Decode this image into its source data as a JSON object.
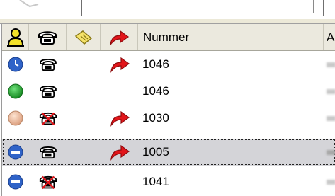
{
  "header": {
    "columns": [
      {
        "icon": "person-icon"
      },
      {
        "icon": "phone-icon"
      },
      {
        "icon": "note-icon"
      },
      {
        "icon": "forward-arrow-icon"
      },
      {
        "label": "Nummer"
      },
      {
        "label": "A"
      }
    ]
  },
  "rows": [
    {
      "status": "blue-clock",
      "phone": "phone",
      "forward": true,
      "nummer": "1046",
      "selected": false
    },
    {
      "status": "green",
      "phone": "phone",
      "forward": false,
      "nummer": "1046",
      "selected": false
    },
    {
      "status": "peach",
      "phone": "phone-disabled",
      "forward": true,
      "nummer": "1030",
      "selected": false
    },
    {
      "status": "blue-dnd",
      "phone": "phone",
      "forward": true,
      "nummer": "1005",
      "selected": true
    },
    {
      "status": "blue-dnd",
      "phone": "phone-disabled",
      "forward": false,
      "nummer": "1041",
      "selected": false
    }
  ],
  "colors": {
    "header_bg": "#ebe9de",
    "selected_bg": "#d4d4d8",
    "status_blue": "#2f63c8",
    "status_green": "#22a82f",
    "status_peach": "#efc1a2",
    "forward_red": "#e2151a"
  }
}
